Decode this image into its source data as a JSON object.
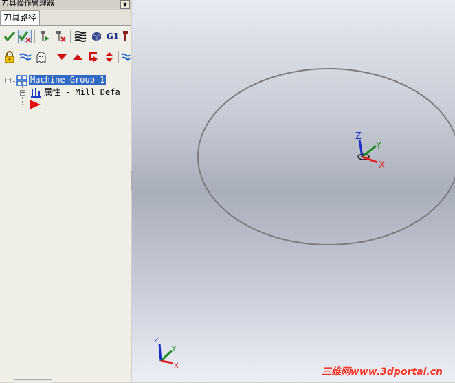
{
  "panel": {
    "title": "刀具操作管理器",
    "tab": "刀具路径"
  },
  "toolbar1": {
    "icons": [
      "select-all-icon",
      "regenerate-selected-icon",
      "backplot-icon",
      "verify-icon",
      "highspeed-icon",
      "stock-icon",
      "g1-post-icon",
      "post-icon"
    ],
    "g1_label": "G1"
  },
  "toolbar2": {
    "icons": [
      "lock-icon",
      "toggle-display-icon",
      "ghost-icon",
      "move-down-icon",
      "move-up-icon",
      "insert-arrow-icon",
      "scroll-icon",
      "highspeed-icon-2"
    ]
  },
  "tree": {
    "machine_group": "Machine Group-1",
    "properties": "属性 - Mill Defa"
  },
  "viewport": {
    "gizmo_center": {
      "x": "X",
      "y": "Y",
      "z": "Z"
    },
    "gizmo_corner": {
      "x": "X",
      "y": "Y",
      "z": "Z"
    },
    "watermark": "三维网www.3dportal.cn"
  },
  "colors": {
    "selection": "#316ac5",
    "axis_x": "#e02020",
    "axis_y": "#1a8a1a",
    "axis_z": "#1a2cc8",
    "watermark": "#ff3a2a"
  }
}
